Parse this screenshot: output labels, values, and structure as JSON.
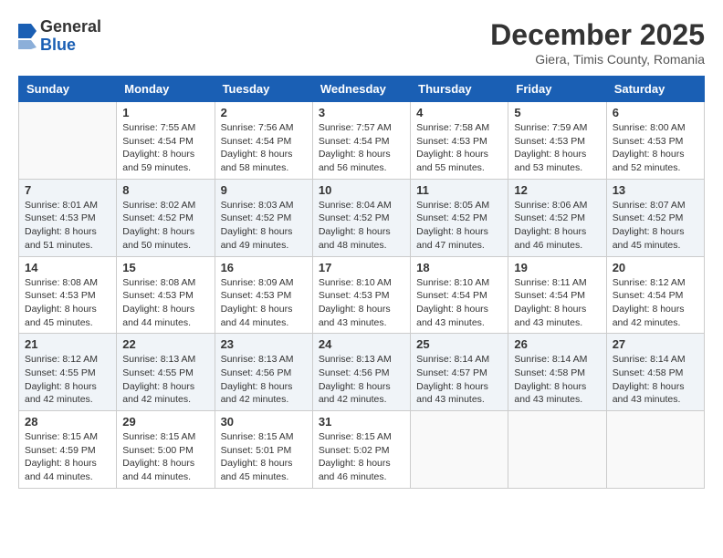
{
  "header": {
    "logo_general": "General",
    "logo_blue": "Blue",
    "month": "December 2025",
    "location": "Giera, Timis County, Romania"
  },
  "weekdays": [
    "Sunday",
    "Monday",
    "Tuesday",
    "Wednesday",
    "Thursday",
    "Friday",
    "Saturday"
  ],
  "weeks": [
    [
      {
        "day": "",
        "info": ""
      },
      {
        "day": "1",
        "info": "Sunrise: 7:55 AM\nSunset: 4:54 PM\nDaylight: 8 hours\nand 59 minutes."
      },
      {
        "day": "2",
        "info": "Sunrise: 7:56 AM\nSunset: 4:54 PM\nDaylight: 8 hours\nand 58 minutes."
      },
      {
        "day": "3",
        "info": "Sunrise: 7:57 AM\nSunset: 4:54 PM\nDaylight: 8 hours\nand 56 minutes."
      },
      {
        "day": "4",
        "info": "Sunrise: 7:58 AM\nSunset: 4:53 PM\nDaylight: 8 hours\nand 55 minutes."
      },
      {
        "day": "5",
        "info": "Sunrise: 7:59 AM\nSunset: 4:53 PM\nDaylight: 8 hours\nand 53 minutes."
      },
      {
        "day": "6",
        "info": "Sunrise: 8:00 AM\nSunset: 4:53 PM\nDaylight: 8 hours\nand 52 minutes."
      }
    ],
    [
      {
        "day": "7",
        "info": "Sunrise: 8:01 AM\nSunset: 4:53 PM\nDaylight: 8 hours\nand 51 minutes."
      },
      {
        "day": "8",
        "info": "Sunrise: 8:02 AM\nSunset: 4:52 PM\nDaylight: 8 hours\nand 50 minutes."
      },
      {
        "day": "9",
        "info": "Sunrise: 8:03 AM\nSunset: 4:52 PM\nDaylight: 8 hours\nand 49 minutes."
      },
      {
        "day": "10",
        "info": "Sunrise: 8:04 AM\nSunset: 4:52 PM\nDaylight: 8 hours\nand 48 minutes."
      },
      {
        "day": "11",
        "info": "Sunrise: 8:05 AM\nSunset: 4:52 PM\nDaylight: 8 hours\nand 47 minutes."
      },
      {
        "day": "12",
        "info": "Sunrise: 8:06 AM\nSunset: 4:52 PM\nDaylight: 8 hours\nand 46 minutes."
      },
      {
        "day": "13",
        "info": "Sunrise: 8:07 AM\nSunset: 4:52 PM\nDaylight: 8 hours\nand 45 minutes."
      }
    ],
    [
      {
        "day": "14",
        "info": "Sunrise: 8:08 AM\nSunset: 4:53 PM\nDaylight: 8 hours\nand 45 minutes."
      },
      {
        "day": "15",
        "info": "Sunrise: 8:08 AM\nSunset: 4:53 PM\nDaylight: 8 hours\nand 44 minutes."
      },
      {
        "day": "16",
        "info": "Sunrise: 8:09 AM\nSunset: 4:53 PM\nDaylight: 8 hours\nand 44 minutes."
      },
      {
        "day": "17",
        "info": "Sunrise: 8:10 AM\nSunset: 4:53 PM\nDaylight: 8 hours\nand 43 minutes."
      },
      {
        "day": "18",
        "info": "Sunrise: 8:10 AM\nSunset: 4:54 PM\nDaylight: 8 hours\nand 43 minutes."
      },
      {
        "day": "19",
        "info": "Sunrise: 8:11 AM\nSunset: 4:54 PM\nDaylight: 8 hours\nand 43 minutes."
      },
      {
        "day": "20",
        "info": "Sunrise: 8:12 AM\nSunset: 4:54 PM\nDaylight: 8 hours\nand 42 minutes."
      }
    ],
    [
      {
        "day": "21",
        "info": "Sunrise: 8:12 AM\nSunset: 4:55 PM\nDaylight: 8 hours\nand 42 minutes."
      },
      {
        "day": "22",
        "info": "Sunrise: 8:13 AM\nSunset: 4:55 PM\nDaylight: 8 hours\nand 42 minutes."
      },
      {
        "day": "23",
        "info": "Sunrise: 8:13 AM\nSunset: 4:56 PM\nDaylight: 8 hours\nand 42 minutes."
      },
      {
        "day": "24",
        "info": "Sunrise: 8:13 AM\nSunset: 4:56 PM\nDaylight: 8 hours\nand 42 minutes."
      },
      {
        "day": "25",
        "info": "Sunrise: 8:14 AM\nSunset: 4:57 PM\nDaylight: 8 hours\nand 43 minutes."
      },
      {
        "day": "26",
        "info": "Sunrise: 8:14 AM\nSunset: 4:58 PM\nDaylight: 8 hours\nand 43 minutes."
      },
      {
        "day": "27",
        "info": "Sunrise: 8:14 AM\nSunset: 4:58 PM\nDaylight: 8 hours\nand 43 minutes."
      }
    ],
    [
      {
        "day": "28",
        "info": "Sunrise: 8:15 AM\nSunset: 4:59 PM\nDaylight: 8 hours\nand 44 minutes."
      },
      {
        "day": "29",
        "info": "Sunrise: 8:15 AM\nSunset: 5:00 PM\nDaylight: 8 hours\nand 44 minutes."
      },
      {
        "day": "30",
        "info": "Sunrise: 8:15 AM\nSunset: 5:01 PM\nDaylight: 8 hours\nand 45 minutes."
      },
      {
        "day": "31",
        "info": "Sunrise: 8:15 AM\nSunset: 5:02 PM\nDaylight: 8 hours\nand 46 minutes."
      },
      {
        "day": "",
        "info": ""
      },
      {
        "day": "",
        "info": ""
      },
      {
        "day": "",
        "info": ""
      }
    ]
  ]
}
